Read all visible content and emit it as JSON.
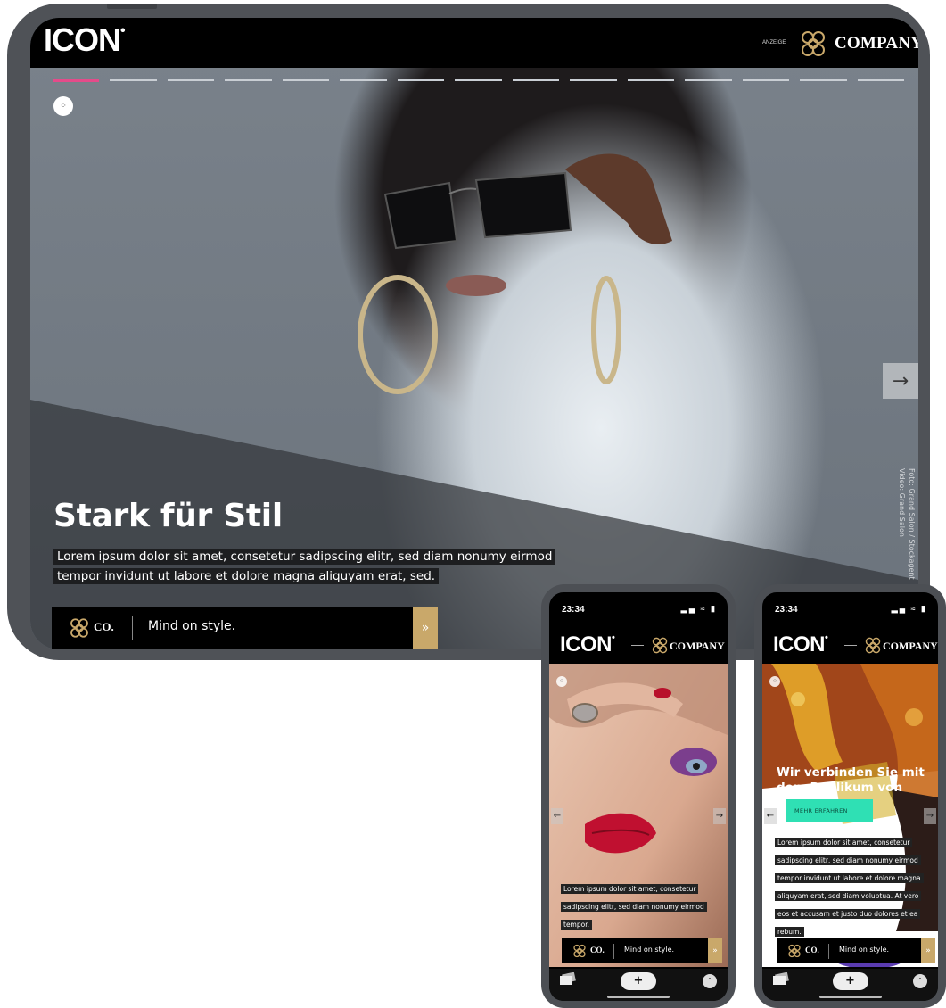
{
  "tablet": {
    "logo": "ICON",
    "logo_mark": "•",
    "ad_label": "ANZEIGE",
    "company": "COMPANY",
    "headline": "Stark für Stil",
    "body": "Lorem ipsum dolor sit amet, consetetur sadipscing elitr, sed diam nonumy eirmod tempor invidunt ut labore et dolore magna aliquyam erat, sed.",
    "credit": "Foto: Grand Salon / Stockagent\nVideo: Grand Salon",
    "ad_bar": {
      "brand": "CO.",
      "tagline": "Mind on style.",
      "cta_icon": "»"
    },
    "next_icon": "→",
    "badge_icon": "⁘",
    "progress": {
      "segments": 15,
      "active": 1
    }
  },
  "phone1": {
    "time": "23:34",
    "status_icons": "▂▄ ≈ ▮",
    "logo": "ICON",
    "logo_mark": "•",
    "company": "COMPANY",
    "body": "Lorem ipsum dolor sit amet, consetetur sadipscing elitr, sed diam nonumy eirmod tempor.",
    "ad_bar": {
      "brand": "CO.",
      "tagline": "Mind on style.",
      "cta_icon": "»"
    },
    "prev_icon": "←",
    "next_icon": "→",
    "plus": "+",
    "up": "⌃"
  },
  "phone2": {
    "time": "23:34",
    "status_icons": "▂▄ ≈ ▮",
    "logo": "ICON",
    "logo_mark": "•",
    "company": "COMPANY",
    "headline": "Wir verbinden Sie mit dem Publikum von ICON.",
    "cta": "MEHR ERFAHREN",
    "body": "Lorem ipsum dolor sit amet, consetetur sadipscing elitr, sed diam nonumy eirmod tempor invidunt ut labore et dolore magna aliquyam erat, sed diam voluptua. At vero eos et accusam et justo duo dolores et ea rebum.",
    "ad_bar": {
      "brand": "CO.",
      "tagline": "Mind on style.",
      "cta_icon": "»"
    },
    "prev_icon": "←",
    "next_icon": "→",
    "plus": "+",
    "up": "⌃"
  },
  "colors": {
    "accent_pink": "#e54b8a",
    "gold": "#c9a86a",
    "mint": "#2fe0b4",
    "frame": "#4f5257"
  }
}
